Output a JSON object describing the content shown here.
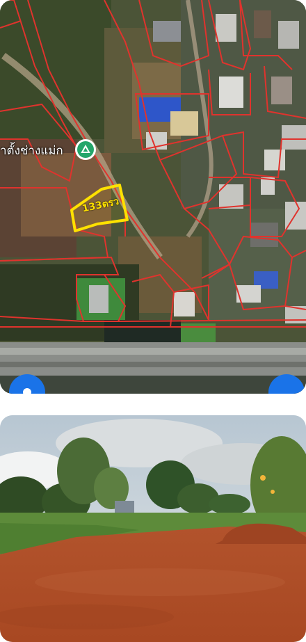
{
  "map": {
    "place_label": "าตั้งช่างแม่ก",
    "plot_label": "133ตรว",
    "colors": {
      "parcel_line": "#e0332d",
      "highlight": "#ffe100",
      "place_marker": "#24a66a",
      "fab": "#1a73e8"
    },
    "icons": [
      "place-marker-icon",
      "left-floating-button",
      "right-floating-button"
    ]
  },
  "photo": {
    "scene": "land-plot-photo"
  }
}
